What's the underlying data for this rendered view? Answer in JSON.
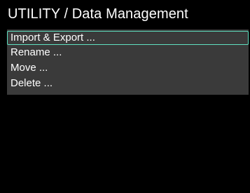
{
  "header": {
    "title": "UTILITY / Data Management"
  },
  "menu": {
    "selected_index": 0,
    "items": [
      {
        "label": "Import & Export ..."
      },
      {
        "label": "Rename ..."
      },
      {
        "label": "Move ..."
      },
      {
        "label": "Delete ..."
      }
    ]
  },
  "colors": {
    "background": "#000000",
    "menu_background": "#3a3a3a",
    "selection_outline": "#5fe0c0",
    "text": "#ffffff"
  }
}
